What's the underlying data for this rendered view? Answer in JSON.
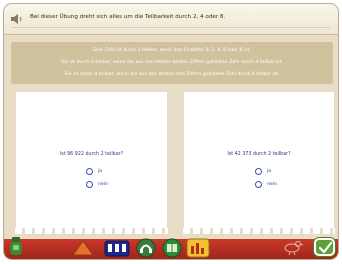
{
  "header": {
    "instruction": "Bei dieser Übung dreht sich alles um die Teilbarkeit durch 2, 4 oder 8."
  },
  "rules": [
    "Eine Zahl ist durch 2 teilbar, wenn ihre Endziffer 0, 2, 4, 6 oder 8 ist.",
    "Sie ist durch 4 teilbar, wenn die aus den letzten beiden Ziffern gebildete Zahl durch 4 teilbar ist.",
    "Sie ist durch 8 teilbar, wenn die aus den letzten drei Ziffern gebildete Zahl durch 8 teilbar ist."
  ],
  "questions": [
    {
      "text": "Ist 96 922 durch 2 teilbar?",
      "options": [
        "ja",
        "nein"
      ]
    },
    {
      "text": "Ist 42 373 durch 2 teilbar?",
      "options": [
        "ja",
        "nein"
      ]
    }
  ],
  "toolbar": {
    "icons": [
      "home-icon",
      "pencil-icon",
      "calculator-icon",
      "headphones-icon",
      "book-icon",
      "chart-icon",
      "bird-icon",
      "check-icon"
    ]
  },
  "colors": {
    "background": "#e8ddc7",
    "rules_panel": "#cfc29c",
    "question_text": "#2a3a8a",
    "toolbar": "#b52d20",
    "check_button": "#5fa039"
  }
}
